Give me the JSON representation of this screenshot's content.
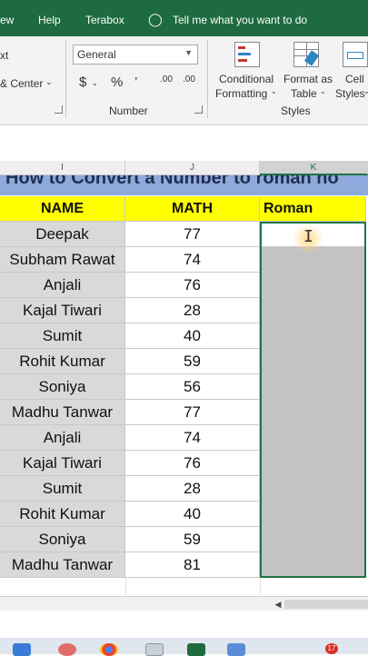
{
  "menubar": {
    "items": [
      "ew",
      "Help",
      "Terabox"
    ],
    "tell_me": "Tell me what you want to do"
  },
  "ribbon": {
    "alignment": {
      "text_fragment": "xt",
      "merge_center": "& Center"
    },
    "number": {
      "format_value": "General",
      "currency_symbol": "$",
      "percent_symbol": "%",
      "comma_symbol": "’",
      "inc_decimal": ".00",
      "dec_decimal": ".00",
      "group_label": "Number"
    },
    "styles": {
      "conditional_line1": "Conditional",
      "conditional_line2": "Formatting",
      "format_table_line1": "Format as",
      "format_table_line2": "Table",
      "cell_line1": "Cell",
      "cell_line2": "Styles",
      "group_label": "Styles"
    }
  },
  "columns": [
    "I",
    "J",
    "K"
  ],
  "sheet_title": "How to Convert a Number to roman no",
  "table": {
    "headers": [
      "NAME",
      "MATH",
      "Roman"
    ],
    "rows": [
      {
        "name": "Deepak",
        "math": "77"
      },
      {
        "name": "Subham Rawat",
        "math": "74"
      },
      {
        "name": "Anjali",
        "math": "76"
      },
      {
        "name": "Kajal Tiwari",
        "math": "28"
      },
      {
        "name": "Sumit",
        "math": "40"
      },
      {
        "name": "Rohit Kumar",
        "math": "59"
      },
      {
        "name": "Soniya",
        "math": "56"
      },
      {
        "name": "Madhu Tanwar",
        "math": "77"
      },
      {
        "name": "Anjali",
        "math": "74"
      },
      {
        "name": "Kajal Tiwari",
        "math": "76"
      },
      {
        "name": "Sumit",
        "math": "28"
      },
      {
        "name": "Rohit Kumar",
        "math": "40"
      },
      {
        "name": "Soniya",
        "math": "59"
      },
      {
        "name": "Madhu Tanwar",
        "math": "81"
      }
    ]
  },
  "colors": {
    "menubar": "#1d6b3f",
    "header_fill": "#ffff00",
    "title_fill": "#8ea9db",
    "selection": "#217346"
  },
  "taskbar": {
    "notification_count": "17"
  }
}
